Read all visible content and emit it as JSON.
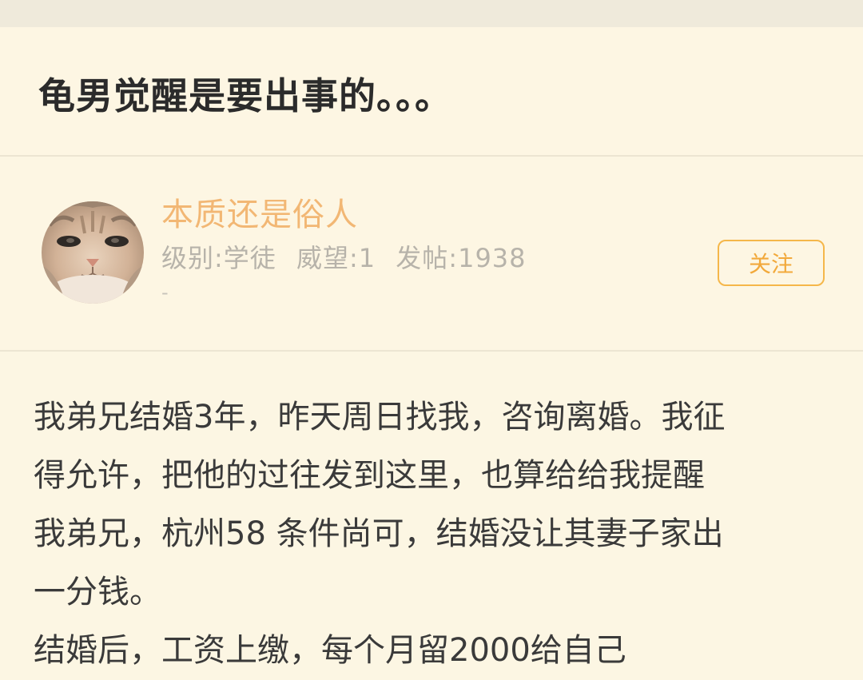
{
  "post": {
    "title": "龟男觉醒是要出事的。。。"
  },
  "author": {
    "name": "本质还是俗人",
    "level": "级别:学徒",
    "prestige": "威望:1",
    "posts": "发帖:1938",
    "extra": "-",
    "follow_label": "关注",
    "avatar_icon": "cat-avatar"
  },
  "body": {
    "lines": [
      "我弟兄结婚3年，昨天周日找我，咨询离婚。我征",
      "得允许，把他的过往发到这里，也算给给我提醒",
      "我弟兄，杭州58 条件尚可，结婚没让其妻子家出",
      "一分钱。",
      "结婚后，工资上缴，每个月留2000给自己"
    ]
  },
  "colors": {
    "background": "#fcf6e3",
    "accent": "#f5b74a",
    "author_name": "#f2b774"
  }
}
